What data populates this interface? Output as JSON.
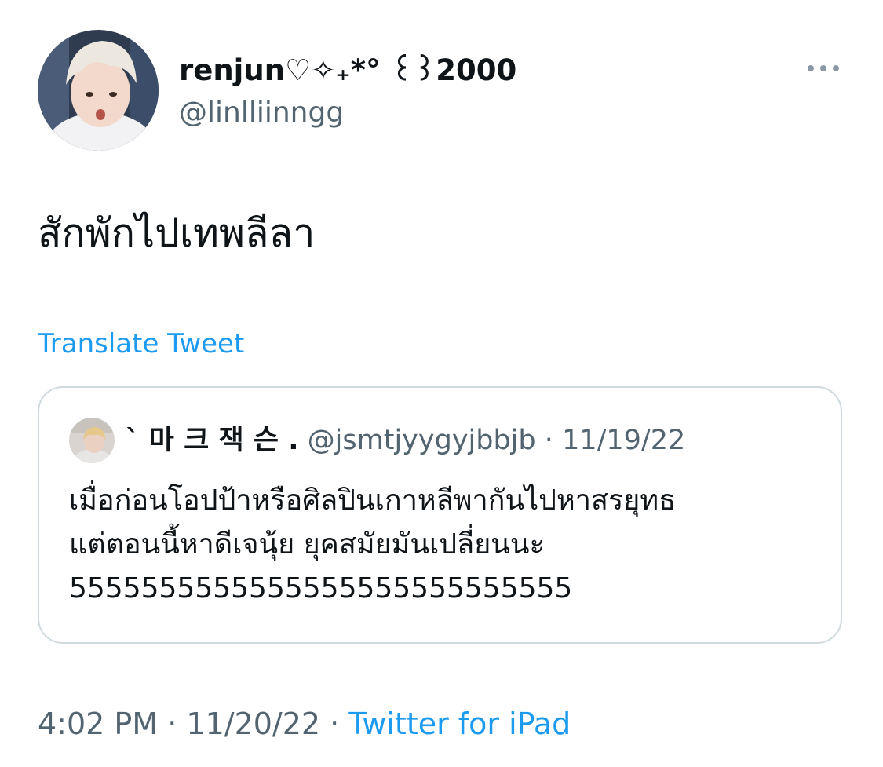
{
  "author": {
    "display_name": "renjun♡✧₊*° ꒰꒱2000",
    "handle": "@linlliinngg"
  },
  "tweet": {
    "text": "สักพักไปเทพลีลา",
    "translate_label": "Translate Tweet"
  },
  "quoted_tweet": {
    "display_name": "` 마 크 잭 슨 .",
    "handle": "@jsmtjyygyjbbjb",
    "separator": "·",
    "date": "11/19/22",
    "lines": [
      "เมื่อก่อนโอปป้าหรือศิลปินเกาหลีพากันไปหาสรยุทธ",
      "แต่ตอนนี้หาดีเจนุ้ย ยุคสมัยมันเปลี่ยนนะ",
      "5555555555555555555555555555"
    ]
  },
  "footer": {
    "time": "4:02 PM",
    "separator": "·",
    "date": "11/20/22",
    "source": "Twitter for iPad"
  },
  "colors": {
    "text": "#0f1419",
    "secondary": "#536471",
    "link": "#1d9bf0",
    "border": "#cfd9de"
  },
  "icons": {
    "more": "more-horizontal-icon"
  }
}
